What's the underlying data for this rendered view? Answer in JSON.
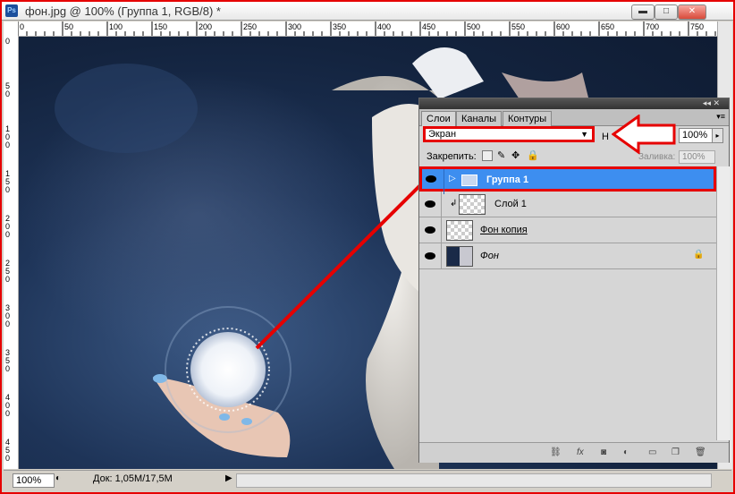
{
  "window": {
    "title": "фон.jpg @ 100% (Группа 1, RGB/8) *",
    "app_icon": "Ps",
    "minimize": "▬",
    "maximize": "□",
    "close": "✕"
  },
  "ruler_top": [
    "0",
    "50",
    "100",
    "150",
    "200",
    "250",
    "300",
    "350",
    "400",
    "450",
    "500",
    "550",
    "600",
    "650",
    "700",
    "750"
  ],
  "ruler_left": [
    "0",
    "5 0",
    "1 0 0",
    "1 5 0",
    "2 0 0",
    "2 5 0",
    "3 0 0",
    "3 5 0",
    "4 0 0",
    "4 5 0"
  ],
  "status": {
    "zoom": "100%",
    "doc": "Док: 1,05M/17,5M"
  },
  "layers_panel": {
    "tabs": [
      "Слои",
      "Каналы",
      "Контуры"
    ],
    "blend_mode": "Экран",
    "opacity_label": "Н",
    "opacity_value": "100%",
    "lock_label": "Закрепить:",
    "fill_label": "Заливка:",
    "fill_value": "100%",
    "layers": [
      {
        "name": "Группа 1",
        "type": "group",
        "selected": true
      },
      {
        "name": "Слой 1",
        "type": "clipped-layer"
      },
      {
        "name": "Фон копия",
        "type": "layer"
      },
      {
        "name": "Фон",
        "type": "background",
        "locked": true
      }
    ]
  },
  "colors": {
    "annotation": "#e60000",
    "selection": "#3d8ef0"
  }
}
